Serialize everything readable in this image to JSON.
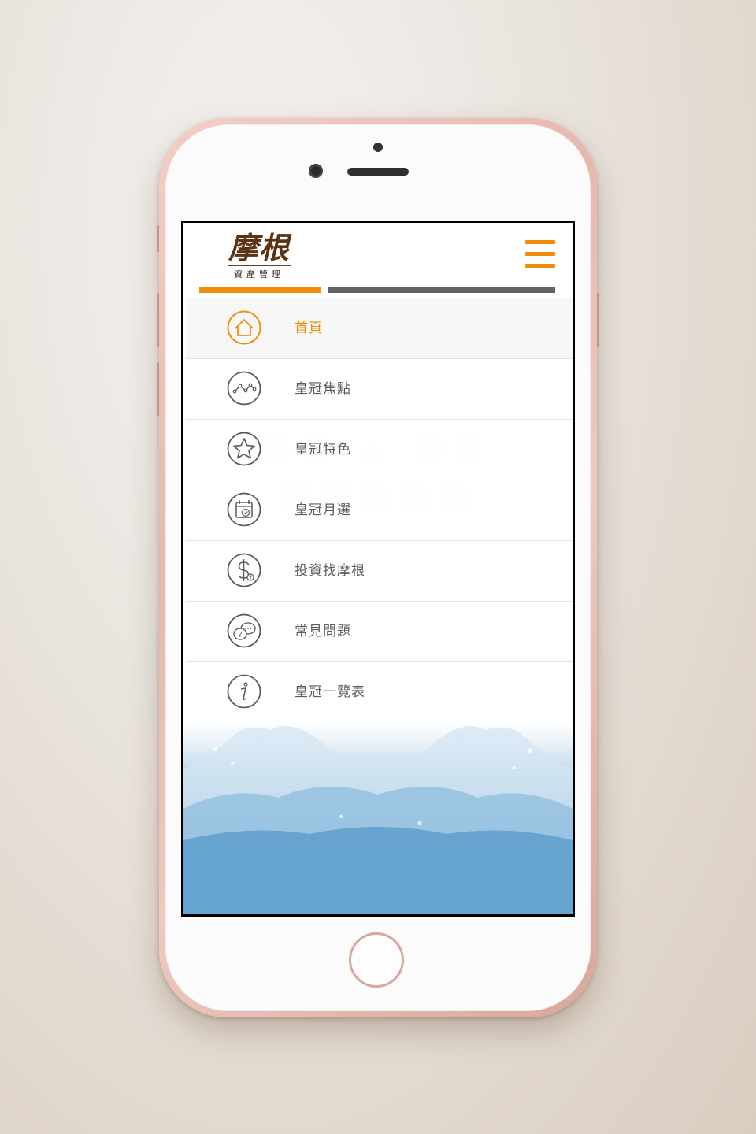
{
  "brand": {
    "logo_main": "摩根",
    "logo_sub": "資產管理",
    "accent_color": "#ef8d0a"
  },
  "header": {
    "menu_icon": "hamburger-icon"
  },
  "menu": {
    "items": [
      {
        "label": "首頁",
        "icon": "home-icon",
        "active": true
      },
      {
        "label": "皇冠焦點",
        "icon": "trend-line-icon",
        "active": false
      },
      {
        "label": "皇冠特色",
        "icon": "star-icon",
        "active": false
      },
      {
        "label": "皇冠月選",
        "icon": "calendar-check-icon",
        "active": false
      },
      {
        "label": "投資找摩根",
        "icon": "dollar-icon",
        "active": false
      },
      {
        "label": "常見問題",
        "icon": "chat-question-icon",
        "active": false
      },
      {
        "label": "皇冠一覽表",
        "icon": "info-icon",
        "active": false
      }
    ]
  }
}
